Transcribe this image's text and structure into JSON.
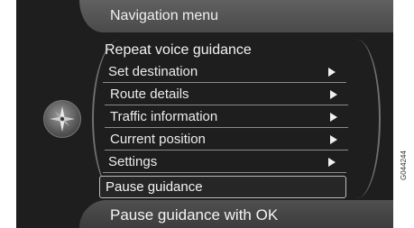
{
  "header": {
    "title": "Navigation menu"
  },
  "menu": {
    "heading": "Repeat voice guidance",
    "items": [
      {
        "label": "Set destination",
        "has_arrow": true
      },
      {
        "label": "Route details",
        "has_arrow": true
      },
      {
        "label": "Traffic information",
        "has_arrow": true
      },
      {
        "label": "Current position",
        "has_arrow": true
      },
      {
        "label": "Settings",
        "has_arrow": true
      },
      {
        "label": "Pause guidance",
        "has_arrow": false,
        "selected": true
      }
    ]
  },
  "footer": {
    "hint": "Pause guidance with OK"
  },
  "side_code": "G044244",
  "icons": {
    "compass": "compass-icon",
    "arrow": "arrow-right-icon"
  }
}
